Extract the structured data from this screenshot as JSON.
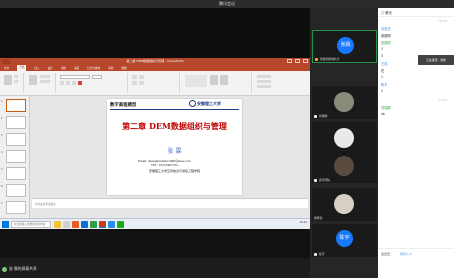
{
  "meeting": {
    "title": "腾讯会议",
    "share_status": "张 霖的屏幕共享"
  },
  "ppt": {
    "title": "第二章 DEM数据组织与管理 - PowerPoint",
    "tabs": [
      "文件",
      "开始",
      "插入",
      "设计",
      "切换",
      "动画",
      "幻灯片放映",
      "审阅",
      "视图"
    ],
    "active_tab": "开始",
    "notes_placeholder": "单击此处添加备注",
    "status_left": "幻灯片 第1张，共35张",
    "zoom": "75%"
  },
  "slide": {
    "course": "数字高程模型",
    "university": "安徽理工大学",
    "chapter_title": "第二章 DEM数据组织与管理",
    "author": "张 霖",
    "email": "Email: zhanglinanhui1980@sina.com",
    "tel": "TEL: 18255487252",
    "department": "安徽理工大学空间信息与测绘工程学院"
  },
  "taskbar": {
    "search_placeholder": "在这里输入你要搜索的内容",
    "time": "10:23"
  },
  "participants": [
    {
      "name": "张霖",
      "avatar_text": "张霖",
      "active": true,
      "sub": "张霖的屏幕共享"
    },
    {
      "name": "刘瑞鹏",
      "avatar_text": "",
      "active": false
    },
    {
      "name": "刘源",
      "avatar_text": "",
      "active": false
    },
    {
      "name": "唐天明好",
      "avatar_text": "",
      "active": false
    },
    {
      "name": "曹梓豪",
      "avatar_text": "",
      "active": false
    },
    {
      "name": "陈宇",
      "avatar_text": "陈宇",
      "active": false
    }
  ],
  "chat": {
    "header": "聊天",
    "messages": [
      {
        "who": "",
        "time": "09:59",
        "text": ""
      },
      {
        "who": "请发送",
        "time": "",
        "text": "",
        "color": "blue"
      },
      {
        "who": "张德明",
        "time": "",
        "text": "",
        "color": "dark"
      },
      {
        "who": "张德明",
        "time": "",
        "text": "",
        "color": "green"
      },
      {
        "who": "",
        "time": "",
        "text": "1"
      },
      {
        "who": "",
        "time": "",
        "text": "3"
      },
      {
        "who": "王成",
        "time": "",
        "text": "",
        "color": "blue"
      },
      {
        "who": "",
        "time": "",
        "text": "在"
      },
      {
        "who": "",
        "time": "",
        "text": "1"
      },
      {
        "who": "陈宇",
        "time": "",
        "text": "",
        "color": "blue"
      },
      {
        "who": "",
        "time": "",
        "text": "1"
      },
      {
        "who": "",
        "time": "10:21",
        "text": ""
      },
      {
        "who": "刘瑞鹏",
        "time": "",
        "text": "",
        "color": "green"
      },
      {
        "who": "",
        "time": "",
        "text": "ok"
      }
    ],
    "send_to_label": "发送至：",
    "send_to_target": "所有人 ▾",
    "toast": "正在讲话：张霖"
  },
  "colors": {
    "ppt_red": "#b7472a",
    "meeting_dark": "#1c1c1c",
    "avatar_blue": "#1677ff",
    "chat_blue": "#3a8ee6",
    "chat_green": "#3aa54a"
  }
}
